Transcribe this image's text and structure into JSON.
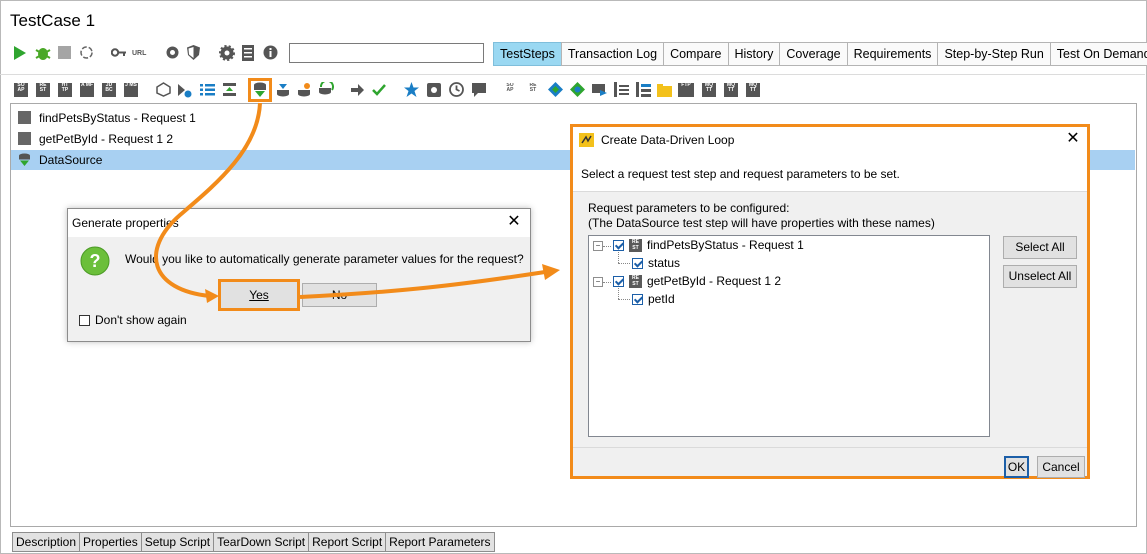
{
  "window": {
    "title": "TestCase 1"
  },
  "toolbar": {
    "url_label": "URL",
    "search_value": ""
  },
  "tabs": [
    {
      "label": "TestSteps",
      "active": true
    },
    {
      "label": "Transaction Log"
    },
    {
      "label": "Compare"
    },
    {
      "label": "History"
    },
    {
      "label": "Coverage"
    },
    {
      "label": "Requirements"
    },
    {
      "label": "Step-by-Step Run"
    },
    {
      "label": "Test On Demand"
    }
  ],
  "steps_toolbar": {
    "icons": [
      "SO AP",
      "RE ST",
      "HT TP",
      "A MF",
      "JD BC",
      "J MS"
    ],
    "right_icons": [
      "SO AP",
      "RE ST",
      "FTP",
      "MQ TT",
      "MQ TT",
      "MQ TT"
    ]
  },
  "tree": {
    "items": [
      {
        "label": "findPetsByStatus - Request 1"
      },
      {
        "label": "getPetById - Request 1 2"
      },
      {
        "label": "DataSource",
        "selected": true
      }
    ]
  },
  "bottom_tabs": [
    "Description",
    "Properties",
    "Setup Script",
    "TearDown Script",
    "Report Script",
    "Report Parameters"
  ],
  "generate_dialog": {
    "title": "Generate properties",
    "message": "Would you like to automatically generate parameter values for the request?",
    "yes_label": "Yes",
    "no_label": "No",
    "dont_show_label": "Don't show again"
  },
  "loop_dialog": {
    "title": "Create Data-Driven Loop",
    "description": "Select a request test step and request parameters to be set.",
    "params_label_1": "Request parameters to be configured:",
    "params_label_2": "(The DataSource test step will have properties with these names)",
    "tree": [
      {
        "label": "findPetsByStatus - Request 1",
        "children": [
          "status"
        ]
      },
      {
        "label": "getPetById - Request 1 2",
        "children": [
          "petId"
        ]
      }
    ],
    "select_all_label": "Select All",
    "unselect_all_label": "Unselect All",
    "ok_label": "OK",
    "cancel_label": "Cancel"
  },
  "colors": {
    "accent_orange": "#f28b1a",
    "active_tab": "#9ad8f2",
    "selection": "#a8d0f2"
  }
}
